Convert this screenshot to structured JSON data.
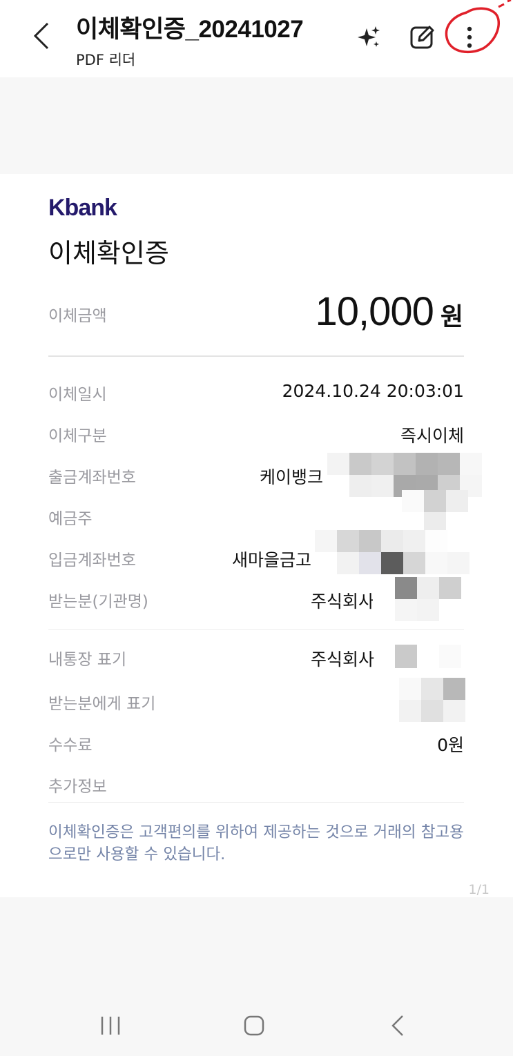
{
  "appbar": {
    "title": "이체확인증_20241027",
    "subtitle": "PDF 리더"
  },
  "document": {
    "logo": "Kbank",
    "title": "이체확인증",
    "amount": {
      "label": "이체금액",
      "value": "10,000",
      "unit": "원"
    },
    "rows": [
      {
        "label": "이체일시",
        "value": "2024.10.24 20:03:01"
      },
      {
        "label": "이체구분",
        "value": "즉시이체"
      },
      {
        "label": "출금계좌번호",
        "value": "케이뱅크"
      },
      {
        "label": "예금주",
        "value": ""
      },
      {
        "label": "입금계좌번호",
        "value": "새마을금고"
      },
      {
        "label": "받는분(기관명)",
        "value": "주식회사"
      },
      {
        "label": "내통장 표기",
        "value": "주식회사"
      },
      {
        "label": "받는분에게 표기",
        "value": ""
      },
      {
        "label": "수수료",
        "value": "0원"
      },
      {
        "label": "추가정보",
        "value": ""
      }
    ],
    "notice": "이체확인증은 고객편의를 위하여 제공하는 것으로 거래의 참고용으로만 사용할 수 있습니다.",
    "page_indicator": "1/1"
  },
  "colors": {
    "brand": "#241a6b",
    "label": "#9a9aa0",
    "notice": "#7484a8",
    "annotation": "#e0202a"
  },
  "icons": {
    "back": "back-arrow-icon",
    "ai": "sparkle-icon",
    "edit": "edit-icon",
    "more": "more-vertical-icon",
    "nav_recents": "recents-icon",
    "nav_home": "home-icon",
    "nav_back": "nav-back-icon"
  }
}
